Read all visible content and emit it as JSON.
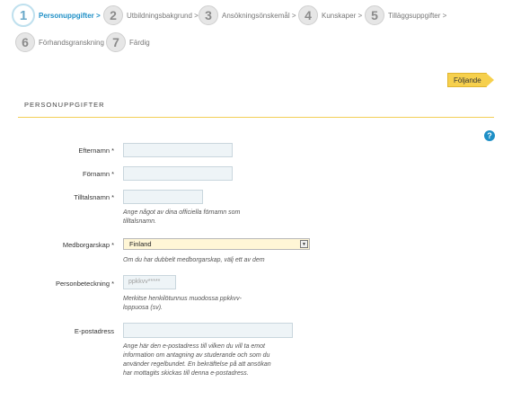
{
  "steps": [
    {
      "num": "1",
      "label": "Personuppgifter >"
    },
    {
      "num": "2",
      "label": "Utbildningsbakgrund >"
    },
    {
      "num": "3",
      "label": "Ansökningsönskemål >"
    },
    {
      "num": "4",
      "label": "Kunskaper >"
    },
    {
      "num": "5",
      "label": "Tilläggsuppgifter >"
    },
    {
      "num": "6",
      "label": "Förhandsgranskning"
    },
    {
      "num": "7",
      "label": "Färdig"
    }
  ],
  "next_button": "Följande",
  "section_title": "PERSONUPPGIFTER",
  "help_icon": "?",
  "fields": {
    "lastname": {
      "label": "Efternamn *"
    },
    "firstnames": {
      "label": "Förnamn *"
    },
    "callname": {
      "label": "Tilltalsnamn *",
      "hint": "Ange något av dina officiella förnamn som tilltalsnamn."
    },
    "citizenship": {
      "label": "Medborgarskap *",
      "value": "Finland",
      "hint": "Om du har dubbelt medborgarskap, välj ett av dem"
    },
    "ssn": {
      "label": "Personbeteckning *",
      "placeholder": "ppkkvv*****",
      "hint": "Merkitse henkilötunnus muodossa ppkkvv-loppuosa (sv)."
    },
    "email": {
      "label": "E-postadress",
      "hint": "Ange här den e-postadress till vilken du vill ta emot information om antagning av studerande och som du använder regelbundet. En bekräftelse på att ansökan har mottagits skickas till denna e-postadress."
    }
  }
}
